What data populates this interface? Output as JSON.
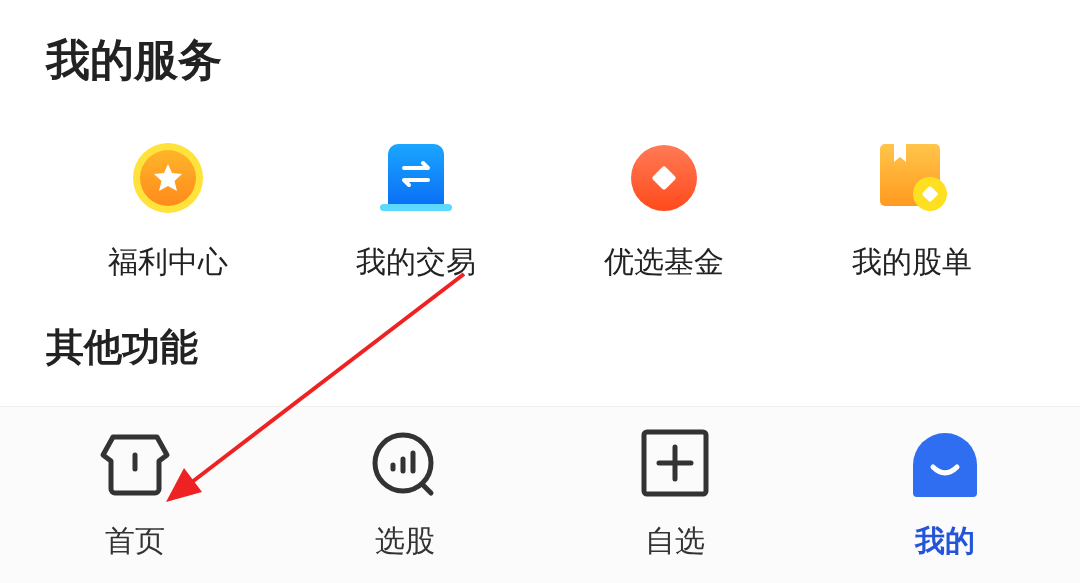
{
  "section_title": "我的服务",
  "services": [
    {
      "kind": "star",
      "label": "福利中心"
    },
    {
      "kind": "transfer",
      "label": "我的交易"
    },
    {
      "kind": "diamond",
      "label": "优选基金"
    },
    {
      "kind": "book",
      "label": "我的股单"
    }
  ],
  "other_title": "其他功能",
  "tab_bar": [
    {
      "kind": "home",
      "label": "首页",
      "selected": false
    },
    {
      "kind": "chart",
      "label": "选股",
      "selected": false
    },
    {
      "kind": "plus",
      "label": "自选",
      "selected": false
    },
    {
      "kind": "face",
      "label": "我的",
      "selected": true
    }
  ],
  "annotation": {
    "kind": "arrow",
    "color": "#ee2222"
  }
}
